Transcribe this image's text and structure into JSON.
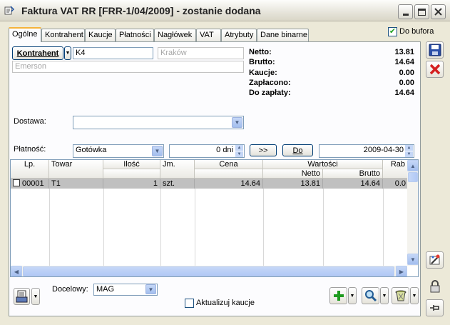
{
  "window": {
    "title": "Faktura VAT RR [FRR-1/04/2009]  - zostanie dodana"
  },
  "tabs": [
    "Ogólne",
    "Kontrahent",
    "Kaucje",
    "Płatności",
    "Nagłówek",
    "VAT",
    "Atrybuty",
    "Dane binarne"
  ],
  "header": {
    "do_bufora_label": "Do bufora",
    "do_bufora_checked": true
  },
  "contractor": {
    "button_label": "Kontrahent",
    "code": "K4",
    "city_placeholder": "Kraków",
    "name_placeholder": "Emerson"
  },
  "summary": [
    {
      "label": "Netto:",
      "value": "13.81"
    },
    {
      "label": "Brutto:",
      "value": "14.64"
    },
    {
      "label": "Kaucje:",
      "value": "0.00"
    },
    {
      "label": "Zapłacono:",
      "value": "0.00"
    },
    {
      "label": "Do zapłaty:",
      "value": "14.64"
    }
  ],
  "delivery": {
    "label": "Dostawa:",
    "value": ""
  },
  "payment": {
    "label": "Płatność:",
    "method": "Gotówka",
    "days": "0 dni",
    "arrow_button": ">>",
    "do_button": "Do",
    "date": "2009-04-30"
  },
  "table": {
    "headers": {
      "lp": "Lp.",
      "towar": "Towar",
      "ilosc": "Ilość",
      "jm": "Jm.",
      "cena": "Cena",
      "wartosci": "Wartości",
      "netto": "Netto",
      "brutto": "Brutto",
      "rabat": "Rab"
    },
    "rows": [
      {
        "lp": "00001",
        "towar": "T1",
        "ilosc": "1",
        "jm": "szt.",
        "cena": "14.64",
        "netto": "13.81",
        "brutto": "14.64",
        "rabat": "0.0"
      }
    ]
  },
  "footer": {
    "docelowy_label": "Docelowy:",
    "docelowy_value": "MAG",
    "aktualizuj_label": "Aktualizuj kaucje",
    "aktualizuj_checked": false
  }
}
